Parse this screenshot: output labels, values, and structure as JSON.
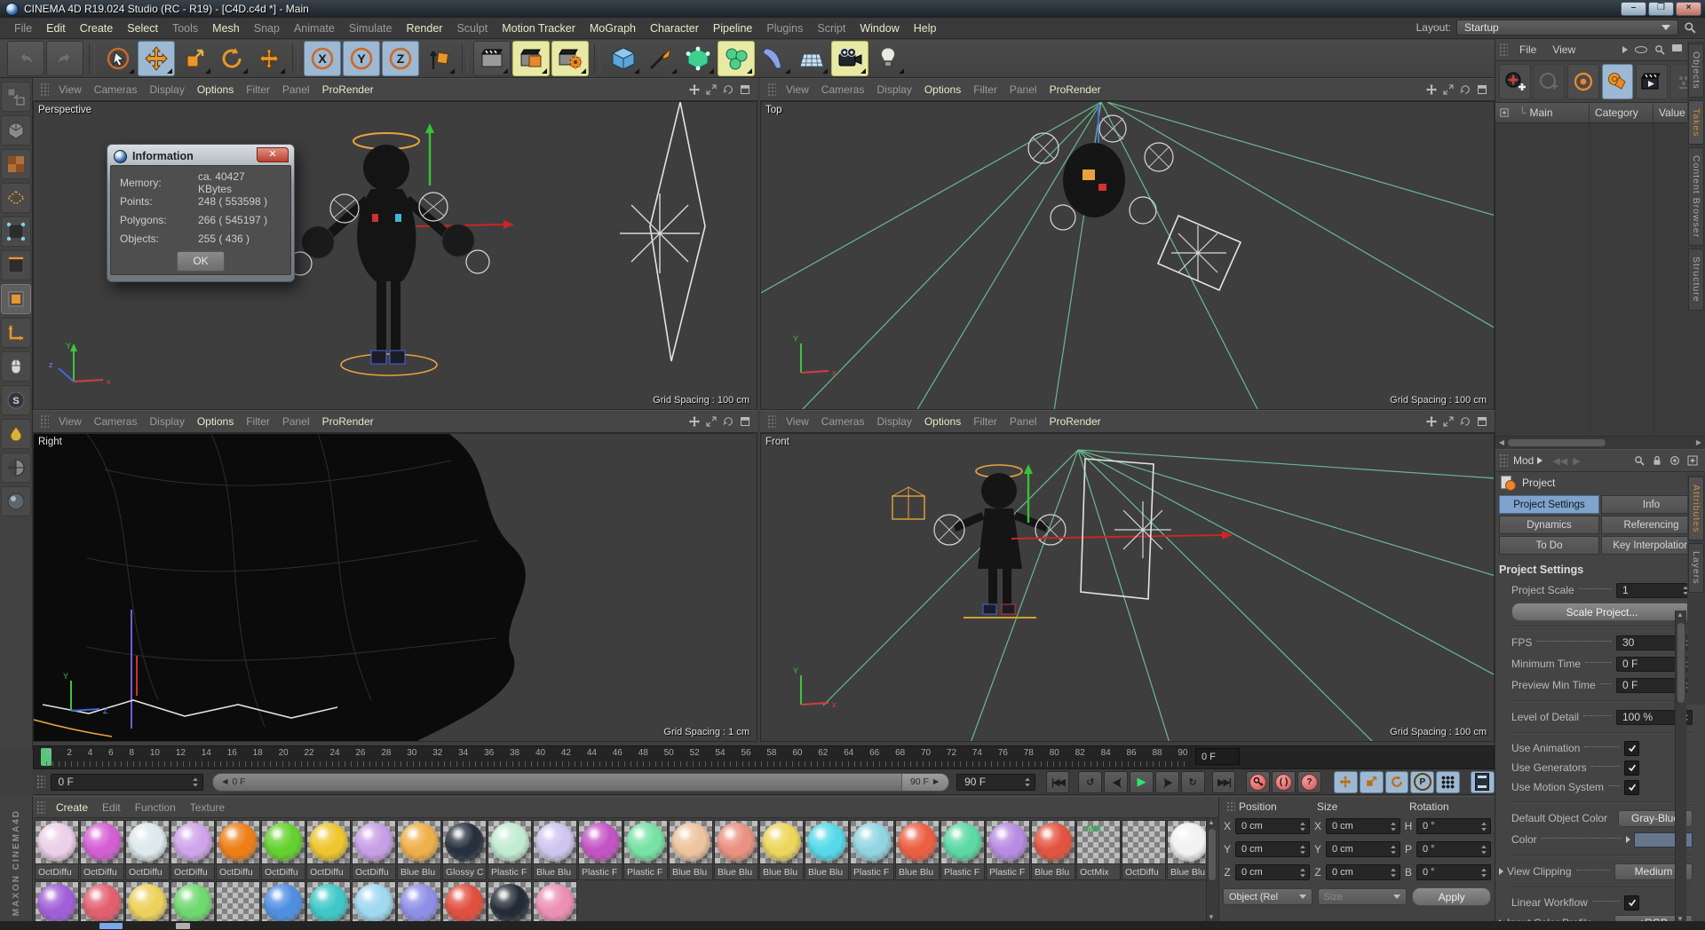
{
  "window": {
    "title": "CINEMA 4D R19.024 Studio (RC - R19) - [C4D.c4d *] - Main",
    "layout_label": "Layout:",
    "layout_value": "Startup",
    "minimize": "–",
    "maximize": "❐",
    "close": "×"
  },
  "menu": {
    "items": [
      {
        "label": "File",
        "bright": false
      },
      {
        "label": "Edit",
        "bright": true
      },
      {
        "label": "Create",
        "bright": true
      },
      {
        "label": "Select",
        "bright": true
      },
      {
        "label": "Tools",
        "bright": false
      },
      {
        "label": "Mesh",
        "bright": true
      },
      {
        "label": "Snap",
        "bright": false
      },
      {
        "label": "Animate",
        "bright": false
      },
      {
        "label": "Simulate",
        "bright": false
      },
      {
        "label": "Render",
        "bright": true
      },
      {
        "label": "Sculpt",
        "bright": false
      },
      {
        "label": "Motion Tracker",
        "bright": true
      },
      {
        "label": "MoGraph",
        "bright": true
      },
      {
        "label": "Character",
        "bright": true
      },
      {
        "label": "Pipeline",
        "bright": true
      },
      {
        "label": "Plugins",
        "bright": false
      },
      {
        "label": "Script",
        "bright": false
      },
      {
        "label": "Window",
        "bright": true
      },
      {
        "label": "Help",
        "bright": true
      }
    ]
  },
  "toolbar_icons": [
    "undo",
    "redo",
    "live-selection",
    "move",
    "scale",
    "rotate",
    "last-tool",
    "x-axis-lock",
    "y-axis-lock",
    "z-axis-lock",
    "coordinate-system",
    "render-view",
    "render-picture-viewer",
    "render-settings",
    "cube-primitive",
    "spline-pen",
    "subdivision-surface",
    "mograph",
    "deformer",
    "floor",
    "camera",
    "light"
  ],
  "left_toolbar_icons": [
    "make-editable",
    "model-mode",
    "texture-mode",
    "workplane-mode",
    "points-mode",
    "edges-mode",
    "polygons-mode",
    "axis-mode",
    "snap-mouse",
    "solo-mode",
    "paint",
    "uv-checker",
    "texture-sphere"
  ],
  "viewport_menu": [
    {
      "label": "View",
      "bright": false
    },
    {
      "label": "Cameras",
      "bright": false
    },
    {
      "label": "Display",
      "bright": false
    },
    {
      "label": "Options",
      "bright": true
    },
    {
      "label": "Filter",
      "bright": false
    },
    {
      "label": "Panel",
      "bright": false
    },
    {
      "label": "ProRender",
      "bright": true
    }
  ],
  "viewports": {
    "perspective": {
      "label": "Perspective",
      "grid": "Grid Spacing : 100 cm"
    },
    "top": {
      "label": "Top",
      "grid": "Grid Spacing : 100 cm"
    },
    "right": {
      "label": "Right",
      "grid": "Grid Spacing : 1 cm"
    },
    "front": {
      "label": "Front",
      "grid": "Grid Spacing : 100 cm"
    }
  },
  "dialog": {
    "title": "Information",
    "rows": [
      {
        "label": "Memory:",
        "value": "ca. 40427 KBytes"
      },
      {
        "label": "Points:",
        "value": "248 ( 553598 )"
      },
      {
        "label": "Polygons:",
        "value": "266 ( 545197 )"
      },
      {
        "label": "Objects:",
        "value": "255 ( 436 )"
      }
    ],
    "ok_label": "OK"
  },
  "take_manager": {
    "menus": [
      {
        "label": "File"
      },
      {
        "label": "View"
      }
    ],
    "columns": [
      "Main",
      "Category",
      "Value"
    ]
  },
  "side_tabs": {
    "top": [
      {
        "label": "Objects",
        "selected": false
      },
      {
        "label": "Takes",
        "selected": true
      },
      {
        "label": "Content Browser",
        "selected": false
      },
      {
        "label": "Structure",
        "selected": false
      }
    ],
    "bottom": [
      {
        "label": "Attributes",
        "selected": true
      },
      {
        "label": "Layers",
        "selected": false
      }
    ]
  },
  "attributes": {
    "mode_label": "Mod",
    "object_label": "Project",
    "tabs": [
      {
        "label": "Project Settings",
        "selected": true
      },
      {
        "label": "Info",
        "selected": false
      },
      {
        "label": "Dynamics",
        "selected": false
      },
      {
        "label": "Referencing",
        "selected": false
      },
      {
        "label": "To Do",
        "selected": false
      },
      {
        "label": "Key Interpolation",
        "selected": false
      }
    ],
    "section_title": "Project Settings",
    "project_scale_label": "Project Scale",
    "project_scale_value": "1",
    "scale_project_button": "Scale Project...",
    "fps_label": "FPS",
    "fps_value": "30",
    "min_time_label": "Minimum Time",
    "min_time_value": "0 F",
    "preview_min_label": "Preview Min Time",
    "preview_min_value": "0 F",
    "lod_label": "Level of Detail",
    "lod_value": "100 %",
    "use_animation_label": "Use Animation",
    "use_generators_label": "Use Generators",
    "use_motion_label": "Use Motion System",
    "default_color_label": "Default Object Color",
    "default_color_value": "Gray-Blue",
    "color_label": "Color",
    "color_swatch": "#66778c",
    "view_clipping_label": "View Clipping",
    "view_clipping_value": "Medium",
    "linear_workflow_label": "Linear Workflow",
    "input_profile_label": "Input Color Profile",
    "input_profile_value": "sRGB"
  },
  "timeline": {
    "ticks": [
      0,
      2,
      4,
      6,
      8,
      10,
      12,
      14,
      16,
      18,
      20,
      22,
      24,
      26,
      28,
      30,
      32,
      34,
      36,
      38,
      40,
      42,
      44,
      46,
      48,
      50,
      52,
      54,
      56,
      58,
      60,
      62,
      64,
      66,
      68,
      70,
      72,
      74,
      76,
      78,
      80,
      82,
      84,
      86,
      88,
      90
    ],
    "current_frame": "0 F",
    "range_start": "0 F",
    "slider_start_label": "◄ 0 F",
    "slider_end_label": "90 F ►",
    "range_end": "90 F"
  },
  "materials": {
    "menus": [
      {
        "label": "Create",
        "bright": true
      },
      {
        "label": "Edit",
        "bright": false
      },
      {
        "label": "Function",
        "bright": false
      },
      {
        "label": "Texture",
        "bright": false
      }
    ],
    "items": [
      {
        "name": "OctDiffu",
        "color": "#eccfe8"
      },
      {
        "name": "OctDiffu",
        "color": "#d45fd4"
      },
      {
        "name": "OctDiffu",
        "color": "#dde9ec"
      },
      {
        "name": "OctDiffu",
        "color": "#cfa4ea"
      },
      {
        "name": "OctDiffu",
        "color": "#ee7f17"
      },
      {
        "name": "OctDiffu",
        "color": "#64d22e"
      },
      {
        "name": "OctDiffu",
        "color": "#eec62e"
      },
      {
        "name": "OctDiffu",
        "color": "#c79fe6"
      },
      {
        "name": "Blue Blu",
        "color": "#eeb04a"
      },
      {
        "name": "Glossy C",
        "color": "#27303c"
      },
      {
        "name": "Plastic F",
        "color": "#c2ecd2"
      },
      {
        "name": "Blue Blu",
        "color": "#cfc6ef"
      },
      {
        "name": "Plastic F",
        "color": "#c454c4"
      },
      {
        "name": "Plastic F",
        "color": "#77e2a4"
      },
      {
        "name": "Blue Blu",
        "color": "#edc49e"
      },
      {
        "name": "Blue Blu",
        "color": "#ea9181"
      },
      {
        "name": "Blue Blu",
        "color": "#ecd75c"
      },
      {
        "name": "Blue Blu",
        "color": "#55d9ea"
      },
      {
        "name": "Plastic F",
        "color": "#92d5e2"
      },
      {
        "name": "Blue Blu",
        "color": "#ec5f41"
      },
      {
        "name": "Plastic F",
        "color": "#5cd9a4"
      },
      {
        "name": "Plastic F",
        "color": "#b78ce2"
      },
      {
        "name": "Blue Blu",
        "color": "#e25440"
      },
      {
        "name": "OctMix",
        "checker": true,
        "mix": "MIX"
      },
      {
        "name": "OctDiffu",
        "checker": true
      },
      {
        "name": "Blue Blu",
        "color": "#f2f2f2"
      }
    ],
    "row2": [
      {
        "color": "#a05fd8"
      },
      {
        "color": "#e2606e"
      },
      {
        "color": "#ecd25c"
      },
      {
        "color": "#6fd86f"
      },
      {
        "checker": true
      },
      {
        "color": "#4f8fe2"
      },
      {
        "color": "#3fc8c8"
      },
      {
        "color": "#9fd8ef"
      },
      {
        "color": "#8f8fe8"
      },
      {
        "color": "#e24f3f"
      },
      {
        "color": "#232c36"
      },
      {
        "color": "#ec8fb4"
      }
    ]
  },
  "coordinates": {
    "headers": [
      "Position",
      "Size",
      "Rotation"
    ],
    "pos": {
      "x": "0 cm",
      "y": "0 cm",
      "z": "0 cm"
    },
    "size": {
      "x": "0 cm",
      "y": "0 cm",
      "z": "0 cm"
    },
    "rot": {
      "h": "0 °",
      "p": "0 °",
      "b": "0 °"
    },
    "axis_pos": [
      "X",
      "Y",
      "Z"
    ],
    "axis_rot": [
      "H",
      "P",
      "B"
    ],
    "object_mode": "Object (Rel",
    "size_mode": "Size",
    "apply_label": "Apply"
  },
  "branding": {
    "left_strip": "MAXON   CINEMA4D"
  },
  "colors": {
    "accent_orange": "#e8872b",
    "selection_blue": "#7fa3cc",
    "highlight_yellow": "#e9e9a6",
    "play_green": "#2fe56f",
    "takes_orange": "#d0893c",
    "frustum_green": "#72cfa0"
  }
}
